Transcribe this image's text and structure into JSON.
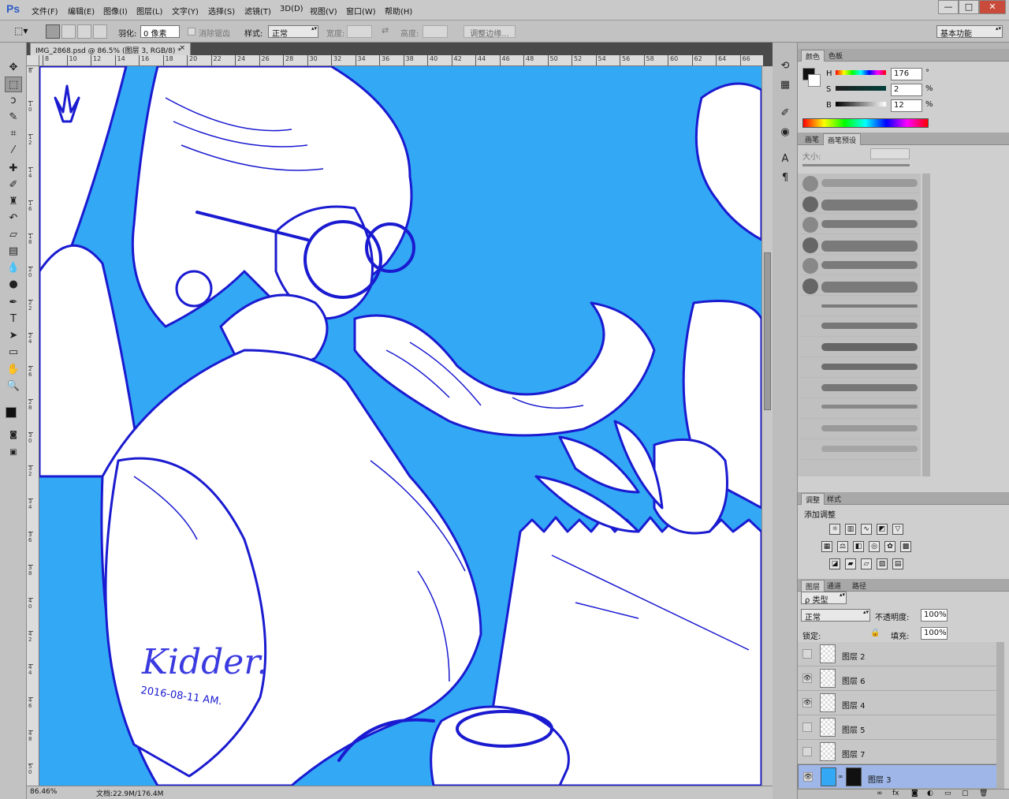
{
  "app": {
    "logo": "Ps"
  },
  "menu": [
    "文件(F)",
    "编辑(E)",
    "图像(I)",
    "图层(L)",
    "文字(Y)",
    "选择(S)",
    "滤镜(T)",
    "3D(D)",
    "视图(V)",
    "窗口(W)",
    "帮助(H)"
  ],
  "window_buttons": {
    "min": "—",
    "max": "□",
    "close": "✕"
  },
  "options": {
    "feather_label": "羽化:",
    "feather_value": "0 像素",
    "antialias_label": "消除锯齿",
    "style_label": "样式:",
    "style_value": "正常",
    "width_label": "宽度:",
    "height_label": "高度:",
    "refine_label": "调整边缘...",
    "workspace": "基本功能"
  },
  "document": {
    "tab_title": "IMG_2868.psd @ 86.5% (图层 3, RGB/8) *",
    "close": "×",
    "zoom": "86.46%",
    "doc_info": "文档:22.9M/176.4M"
  },
  "ruler": {
    "h_ticks": [
      "8",
      "10",
      "12",
      "14",
      "16",
      "18",
      "20",
      "22",
      "24",
      "26",
      "28",
      "30",
      "32",
      "34",
      "36",
      "38",
      "40",
      "42",
      "44",
      "46",
      "48",
      "50",
      "52",
      "54",
      "56",
      "58",
      "60",
      "62",
      "64",
      "66"
    ],
    "v_ticks": [
      "8",
      "1 0",
      "1 2",
      "1 4",
      "1 6",
      "1 8",
      "2 0",
      "2 2",
      "2 4",
      "2 6",
      "2 8",
      "3 0",
      "3 2",
      "3 4",
      "3 6",
      "3 8",
      "4 0",
      "4 2",
      "4 4",
      "4 6",
      "4 8",
      "5 0"
    ]
  },
  "artwork": {
    "signature": "Kidder.",
    "date": "2016-08-11 AM."
  },
  "colors": {
    "background": "#33a8f5",
    "line": "#1a1ad0",
    "fg_swatch": "#111111",
    "bg_swatch": "#ffffff"
  },
  "color_panel": {
    "tabs": [
      "颜色",
      "色板"
    ],
    "h_label": "H",
    "h_value": "176",
    "h_unit": "°",
    "s_label": "S",
    "s_value": "2",
    "s_unit": "%",
    "b_label": "B",
    "b_value": "12",
    "b_unit": "%"
  },
  "brush_panel": {
    "tabs": [
      "画笔",
      "画笔预设"
    ],
    "size_label": "大小:"
  },
  "adjust_panel": {
    "tabs": [
      "调整",
      "样式"
    ],
    "title": "添加调整"
  },
  "layers_panel": {
    "tabs": [
      "图层",
      "通道",
      "路径"
    ],
    "kind": "ρ 类型",
    "blend": "正常",
    "opacity_label": "不透明度:",
    "opacity": "100%",
    "lock_label": "锁定:",
    "fill_label": "填充:",
    "fill": "100%",
    "layers": [
      {
        "name": "图层 2",
        "visible": false
      },
      {
        "name": "图层 6",
        "visible": true
      },
      {
        "name": "图层 4",
        "visible": true
      },
      {
        "name": "图层 5",
        "visible": false
      },
      {
        "name": "图层 7",
        "visible": false
      },
      {
        "name": "图层 3",
        "visible": true,
        "selected": true
      }
    ]
  }
}
